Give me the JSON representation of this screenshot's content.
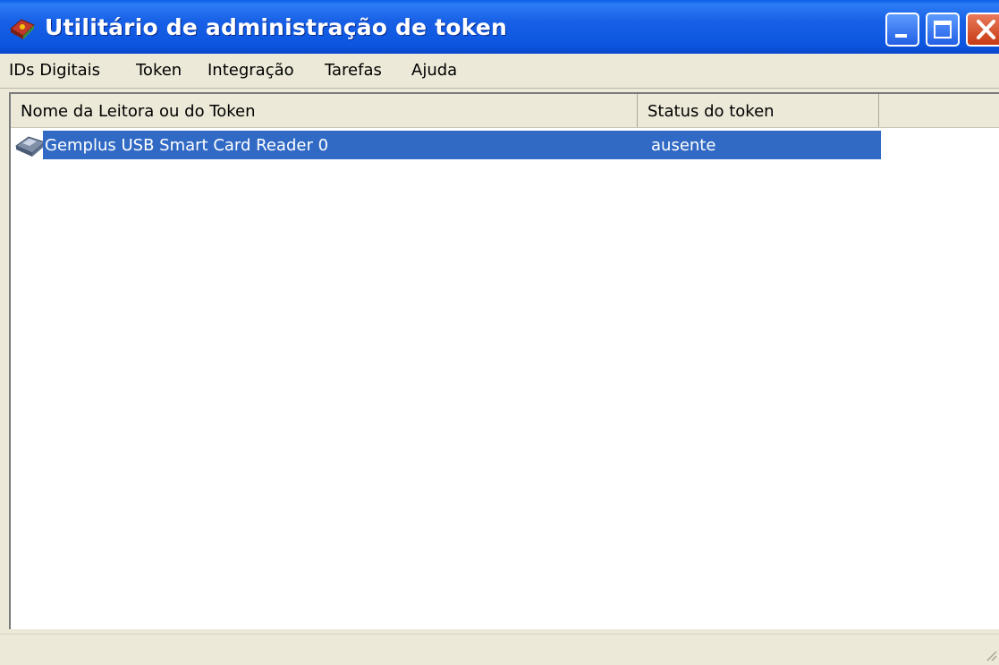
{
  "window": {
    "title": "Utilitário de administração de token"
  },
  "menu": [
    {
      "label": "IDs Digitais"
    },
    {
      "label": "Token"
    },
    {
      "label": "Integração"
    },
    {
      "label": "Tarefas"
    },
    {
      "label": "Ajuda"
    }
  ],
  "list": {
    "columns": [
      "Nome da Leitora ou do Token",
      "Status do token"
    ],
    "rows": [
      {
        "name": "Gemplus USB Smart Card Reader 0",
        "status": "ausente",
        "selected": true,
        "icon": "card-reader-icon"
      }
    ]
  },
  "colors": {
    "titlebar": "#0c55df",
    "selection": "#316ac5",
    "close_button": "#c73b14",
    "chrome": "#ece9d8"
  }
}
